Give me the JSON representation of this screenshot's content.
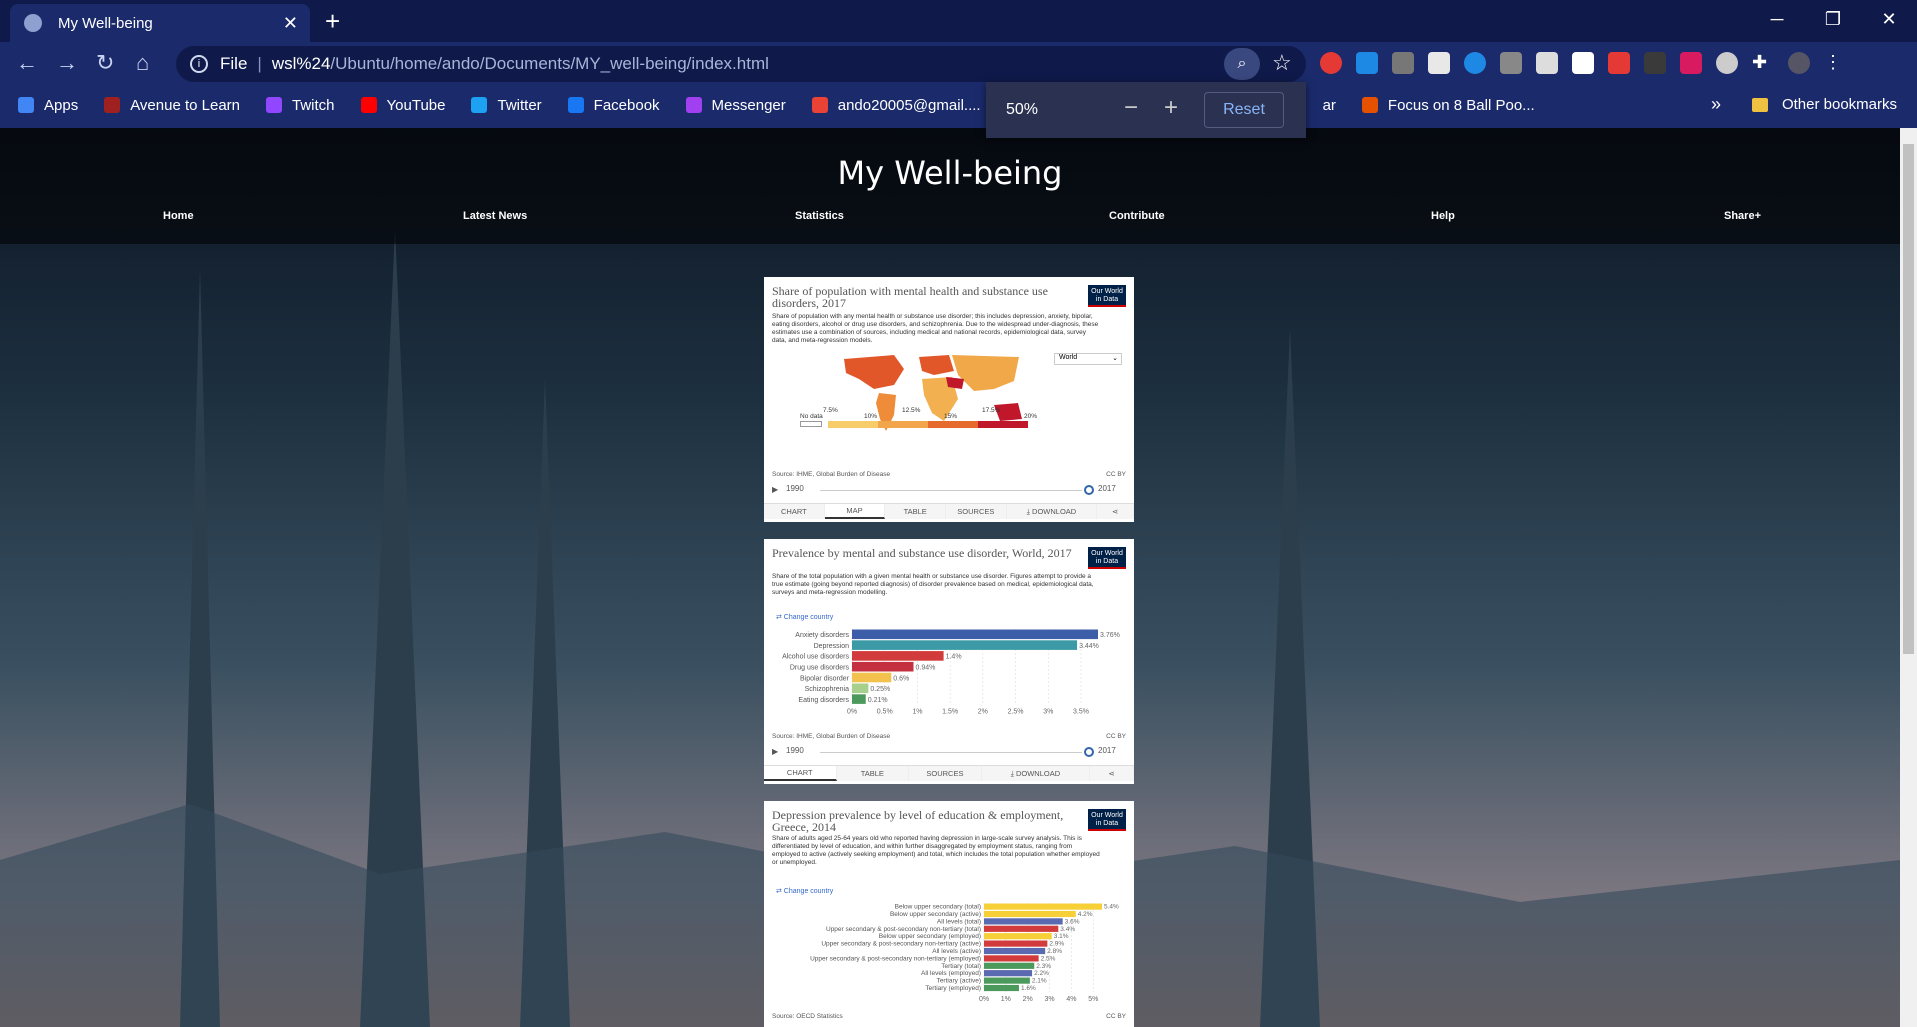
{
  "browser": {
    "tab_title": "My Well-being",
    "url_scheme": "File",
    "url_host": "wsl%24",
    "url_path": "/Ubuntu/home/ando/Documents/MY_well-being/index.html",
    "bookmarks": [
      {
        "label": "Apps",
        "color": "#4285f4"
      },
      {
        "label": "Avenue to Learn",
        "color": "#a02020"
      },
      {
        "label": "Twitch",
        "color": "#9146ff"
      },
      {
        "label": "YouTube",
        "color": "#ff0000"
      },
      {
        "label": "Twitter",
        "color": "#1da1f2"
      },
      {
        "label": "Facebook",
        "color": "#1877f2"
      },
      {
        "label": "Messenger",
        "color": "#a040f0"
      },
      {
        "label": "ando20005@gmail....",
        "color": "#ea4335"
      }
    ],
    "bookmark_partial": "ar",
    "bookmark_focus": "Focus on 8 Ball Poo...",
    "more_label": "»",
    "other_bookmarks": "Other bookmarks",
    "zoom": {
      "level": "50%",
      "minus": "−",
      "plus": "+",
      "reset": "Reset"
    }
  },
  "site": {
    "title": "My Well-being",
    "nav": [
      "Home",
      "Latest News",
      "Statistics",
      "Contribute",
      "Help",
      "Share+"
    ]
  },
  "cards": [
    {
      "title": "Share of population with mental health and substance use disorders, 2017",
      "subtitle": "Share of population with any mental health or substance use disorder; this includes depression, anxiety, bipolar, eating disorders, alcohol or drug use disorders, and schizophrenia. Due to the widespread under-diagnosis, these estimates use a combination of sources, including medical and national records, epidemiological data, survey data, and meta-regression models.",
      "logo": "Our World in Data",
      "region_select": "World",
      "legend": [
        "No data",
        "7.5%",
        "10%",
        "12.5%",
        "15%",
        "17.5%",
        "20%"
      ],
      "source": "Source: IHME, Global Burden of Disease",
      "license": "CC BY",
      "start_year": "1990",
      "end_year": "2017",
      "tabs": [
        "CHART",
        "MAP",
        "TABLE",
        "SOURCES",
        "⤓ DOWNLOAD",
        "⋖"
      ]
    },
    {
      "title": "Prevalence by mental and substance use disorder, World, 2017",
      "subtitle": "Share of the total population with a given mental health or substance use disorder. Figures attempt to provide a true estimate (going beyond reported diagnosis) of disorder prevalence based on medical, epidemiological data, surveys and meta-regression modelling.",
      "logo": "Our World in Data",
      "change_country": "⇄ Change country",
      "source": "Source: IHME, Global Burden of Disease",
      "license": "CC BY",
      "start_year": "1990",
      "end_year": "2017",
      "tabs": [
        "CHART",
        "TABLE",
        "SOURCES",
        "⤓ DOWNLOAD",
        "⋖"
      ]
    },
    {
      "title": "Depression prevalence by level of education & employment, Greece, 2014",
      "subtitle": "Share of adults aged 25-64 years old who reported having depression in large-scale survey analysis. This is differentiated by level of education, and within further disaggregated by employment status, ranging from employed to active (actively seeking employment) and total, which includes the total population whether employed or unemployed.",
      "logo": "Our World in Data",
      "change_country": "⇄ Change country",
      "source": "Source: OECD Statistics",
      "license": "CC BY"
    }
  ],
  "chart_data": [
    {
      "type": "bar",
      "title": "Prevalence by mental and substance use disorder, World, 2017",
      "categories": [
        "Anxiety disorders",
        "Depression",
        "Alcohol use disorders",
        "Drug use disorders",
        "Bipolar disorder",
        "Schizophrenia",
        "Eating disorders"
      ],
      "values": [
        3.76,
        3.44,
        1.4,
        0.94,
        0.6,
        0.25,
        0.21
      ],
      "value_labels": [
        "3.76%",
        "3.44%",
        "1.4%",
        "0.94%",
        "0.6%",
        "0.25%",
        "0.21%"
      ],
      "colors": [
        "#3c5da8",
        "#3b9aa6",
        "#d23b3b",
        "#c4303f",
        "#f2c14e",
        "#a8d08d",
        "#4c9a5b"
      ],
      "xticks": [
        "0%",
        "0.5%",
        "1%",
        "1.5%",
        "2%",
        "2.5%",
        "3%",
        "3.5%"
      ],
      "xlim": [
        0,
        3.76
      ]
    },
    {
      "type": "bar",
      "title": "Depression prevalence by level of education & employment, Greece, 2014",
      "categories": [
        "Below upper secondary (total)",
        "Below upper secondary (active)",
        "All levels (total)",
        "Upper secondary & post-secondary non-tertiary (total)",
        "Below upper secondary (employed)",
        "Upper secondary & post-secondary non-tertiary (active)",
        "All levels (active)",
        "Upper secondary & post-secondary non-tertiary (employed)",
        "Tertiary (total)",
        "All levels (employed)",
        "Tertiary (active)",
        "Tertiary (employed)"
      ],
      "values": [
        5.4,
        4.2,
        3.6,
        3.4,
        3.1,
        2.9,
        2.8,
        2.5,
        2.3,
        2.2,
        2.1,
        1.6
      ],
      "value_labels": [
        "5.4%",
        "4.2%",
        "3.6%",
        "3.4%",
        "3.1%",
        "2.9%",
        "2.8%",
        "2.5%",
        "2.3%",
        "2.2%",
        "2.1%",
        "1.6%"
      ],
      "colors": [
        "#f7d038",
        "#f7d038",
        "#5a6ab0",
        "#d23b3b",
        "#f7d038",
        "#d23b3b",
        "#5a6ab0",
        "#d23b3b",
        "#4c9a5b",
        "#5a6ab0",
        "#4c9a5b",
        "#4c9a5b"
      ],
      "xticks": [
        "0%",
        "1%",
        "2%",
        "3%",
        "4%",
        "5%"
      ],
      "xlim": [
        0,
        5.4
      ]
    }
  ]
}
